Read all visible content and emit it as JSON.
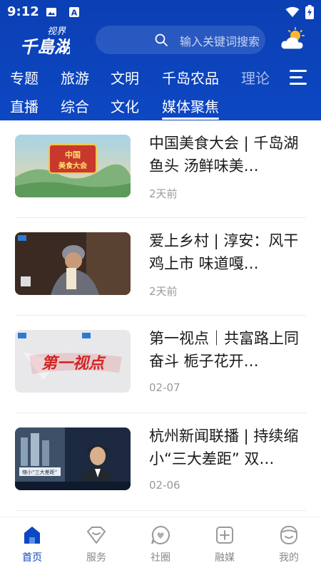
{
  "status": {
    "time": "9:12"
  },
  "header": {
    "logo_line1": "视界",
    "logo_line2": "千島湖",
    "search_placeholder": "输入关键词搜索"
  },
  "nav": {
    "row1": [
      "专题",
      "旅游",
      "文明",
      "千岛农品",
      "理论"
    ],
    "row2": [
      "直播",
      "综合",
      "文化",
      "媒体聚焦"
    ],
    "active": "媒体聚焦"
  },
  "articles": [
    {
      "title": "中国美食大会 | 千岛湖鱼头 汤鲜味美…",
      "date": "2天前",
      "thumb_text": "中国美食大会"
    },
    {
      "title": "爱上乡村 | 淳安：风干鸡上市 味道嘎…",
      "date": "2天前",
      "thumb_text": ""
    },
    {
      "title": "第一视点｜共富路上同奋斗 栀子花开…",
      "date": "02-07",
      "thumb_text": "第一视点"
    },
    {
      "title": "杭州新闻联播 | 持续缩小“三大差距” 双…",
      "date": "02-06",
      "thumb_text": "缩小“三大差距”"
    }
  ],
  "tabbar": {
    "items": [
      "首页",
      "服务",
      "社圈",
      "融媒",
      "我的"
    ],
    "active": "首页"
  },
  "colors": {
    "brand_blue": "#0d47c2",
    "text": "#1a1a1a",
    "muted": "#9a9a9a"
  }
}
